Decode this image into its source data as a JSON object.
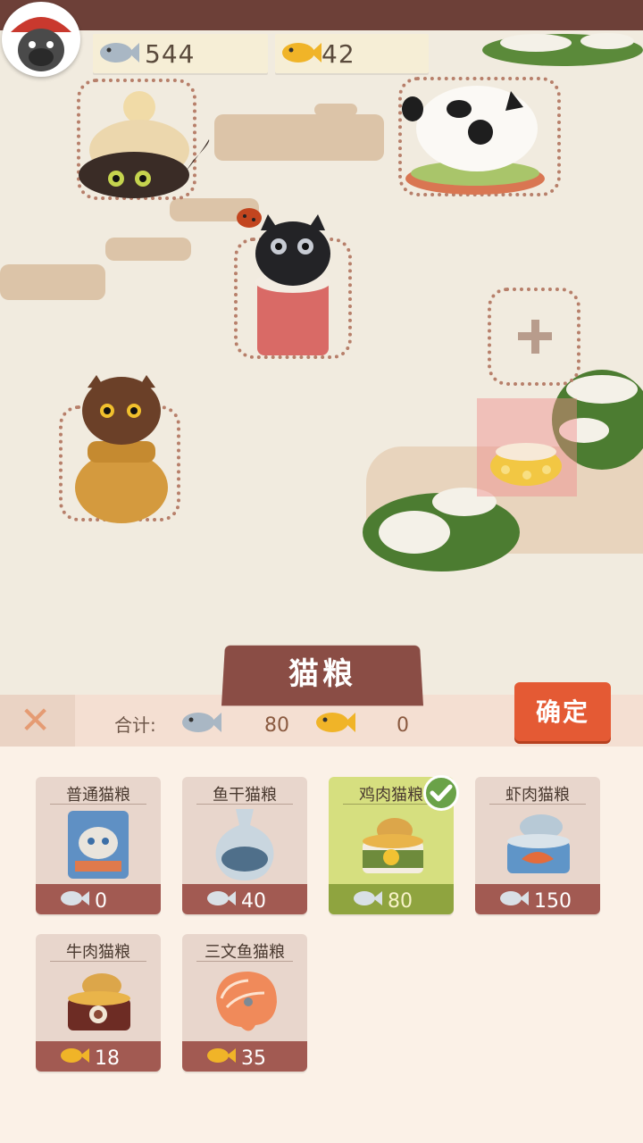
{
  "hud": {
    "fish_count": "544",
    "gold_fish_count": "42"
  },
  "panel": {
    "title": "猫粮",
    "close_symbol": "✕",
    "total_label": "合计:",
    "total_fish": "80",
    "total_gold": "0",
    "confirm_label": "确定"
  },
  "foods": [
    {
      "name": "普通猫粮",
      "price": "0",
      "currency": "fish",
      "selected": false
    },
    {
      "name": "鱼干猫粮",
      "price": "40",
      "currency": "fish",
      "selected": false
    },
    {
      "name": "鸡肉猫粮",
      "price": "80",
      "currency": "fish",
      "selected": true
    },
    {
      "name": "虾肉猫粮",
      "price": "150",
      "currency": "fish",
      "selected": false
    },
    {
      "name": "牛肉猫粮",
      "price": "18",
      "currency": "gold_fish",
      "selected": false
    },
    {
      "name": "三文鱼猫粮",
      "price": "35",
      "currency": "gold_fish",
      "selected": false
    }
  ],
  "colors": {
    "accent": "#e45a34",
    "card_footer": "#a25a52",
    "selected_card": "#d6df7f",
    "check": "#6aa248"
  },
  "icons": {
    "fish": "fish-icon",
    "gold_fish": "gold-fish-icon",
    "check": "check-icon",
    "close": "close-icon"
  }
}
